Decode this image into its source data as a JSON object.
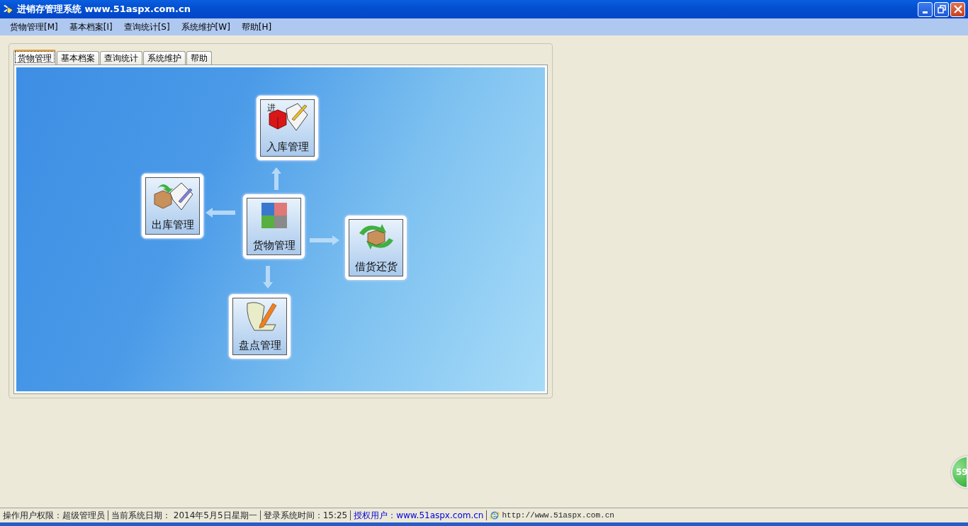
{
  "window": {
    "title": "进销存管理系统 www.51aspx.com.cn"
  },
  "menu": [
    "货物管理[M]",
    "基本档案[I]",
    "查询统计[S]",
    "系统维护[W]",
    "帮助[H]"
  ],
  "tabs": [
    {
      "label": "货物管理",
      "selected": true
    },
    {
      "label": "基本档案",
      "selected": false
    },
    {
      "label": "查询统计",
      "selected": false
    },
    {
      "label": "系统维护",
      "selected": false
    },
    {
      "label": "帮助",
      "selected": false
    }
  ],
  "nodes": [
    {
      "kind": "stock-in",
      "label": "入库管理",
      "icon_text": "进"
    },
    {
      "kind": "stock-out",
      "label": "出库管理"
    },
    {
      "kind": "goods",
      "label": "货物管理"
    },
    {
      "kind": "borrow",
      "label": "借货还货"
    },
    {
      "kind": "inventory",
      "label": "盘点管理"
    }
  ],
  "floating_badge": "59",
  "status_bar": [
    {
      "kind": "text",
      "text": "操作用户权限：超级管理员"
    },
    {
      "kind": "text",
      "text": "当前系统日期： 2014年5月5日星期一"
    },
    {
      "kind": "text",
      "text": "登录系统时间：15:25"
    },
    {
      "kind": "link",
      "text": "授权用户：www.51aspx.com.cn"
    },
    {
      "kind": "web",
      "text": "http://www.51aspx.com.cn"
    }
  ]
}
